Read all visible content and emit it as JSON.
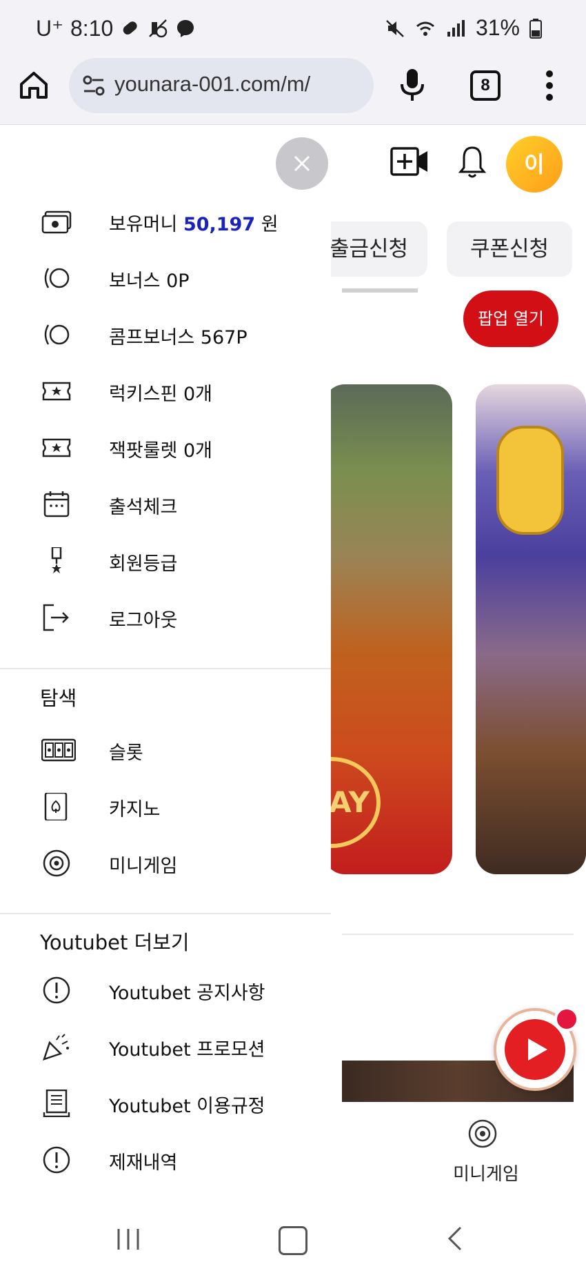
{
  "status_bar": {
    "carrier": "U⁺",
    "time": "8:10",
    "battery": "31%",
    "icons": [
      "pill-icon",
      "silent-alarm-icon",
      "messenger-icon",
      "mute-icon",
      "wifi-icon",
      "signal-icon",
      "battery-icon"
    ]
  },
  "browser": {
    "url": "younara-001.com/m/",
    "tab_count": "8"
  },
  "background_page": {
    "chips": [
      "출금신청",
      "쿠폰신청"
    ],
    "popup_button": "팝업 열기",
    "avatar_letter": "이",
    "banner_text": "AY",
    "bottom_nav_label": "미니게임"
  },
  "drawer": {
    "wallet": {
      "label": "보유머니",
      "value": "50,197",
      "unit": "원"
    },
    "account_items": [
      {
        "label": "보너스 0P",
        "icon": "bonus-icon"
      },
      {
        "label": "콤프보너스 567P",
        "icon": "comp-bonus-icon"
      },
      {
        "label": "럭키스핀 0개",
        "icon": "ticket-icon"
      },
      {
        "label": "잭팟룰렛 0개",
        "icon": "ticket-icon"
      },
      {
        "label": "출석체크",
        "icon": "calendar-icon"
      },
      {
        "label": "회원등급",
        "icon": "medal-icon"
      },
      {
        "label": "로그아웃",
        "icon": "logout-icon"
      }
    ],
    "explore": {
      "title": "탐색",
      "items": [
        {
          "label": "슬롯",
          "icon": "slot-icon"
        },
        {
          "label": "카지노",
          "icon": "card-icon"
        },
        {
          "label": "미니게임",
          "icon": "chip-icon"
        }
      ]
    },
    "more": {
      "title": "Youtubet 더보기",
      "items": [
        {
          "label": "Youtubet 공지사항",
          "icon": "notice-icon"
        },
        {
          "label": "Youtubet 프로모션",
          "icon": "party-icon"
        },
        {
          "label": "Youtubet 이용규정",
          "icon": "document-icon"
        },
        {
          "label": "제재내역",
          "icon": "notice-icon"
        }
      ]
    }
  },
  "colors": {
    "accent_value": "#1b24b8",
    "popup_red": "#d30f16",
    "avatar_gold": "#ffb61f"
  }
}
